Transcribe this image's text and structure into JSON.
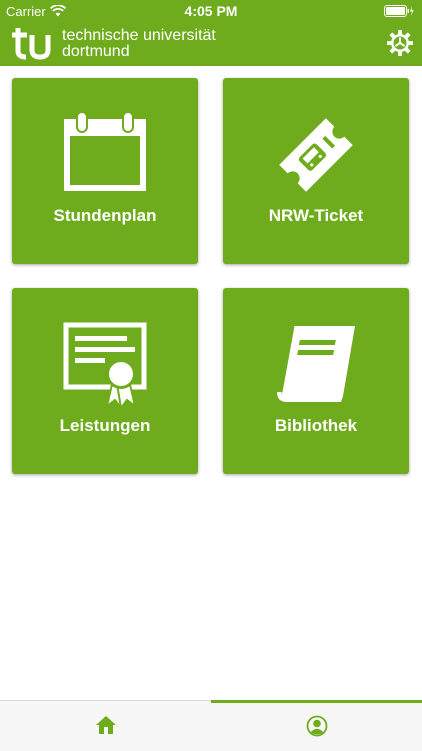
{
  "status_bar": {
    "carrier": "Carrier",
    "time": "4:05 PM"
  },
  "header": {
    "logo_line1": "technische universität",
    "logo_line2": "dortmund",
    "logo_mark": "tu",
    "settings_icon": "gear-icon"
  },
  "tiles": [
    {
      "label": "Stundenplan",
      "icon": "calendar-icon"
    },
    {
      "label": "NRW-Ticket",
      "icon": "ticket-icon"
    },
    {
      "label": "Leistungen",
      "icon": "certificate-icon"
    },
    {
      "label": "Bibliothek",
      "icon": "book-icon"
    }
  ],
  "tab_bar": [
    {
      "icon": "home-icon",
      "active": false
    },
    {
      "icon": "profile-icon",
      "active": true
    }
  ],
  "colors": {
    "accent": "#6fac1d",
    "background": "#ffffff",
    "tab_bar": "#f7f7f7"
  }
}
